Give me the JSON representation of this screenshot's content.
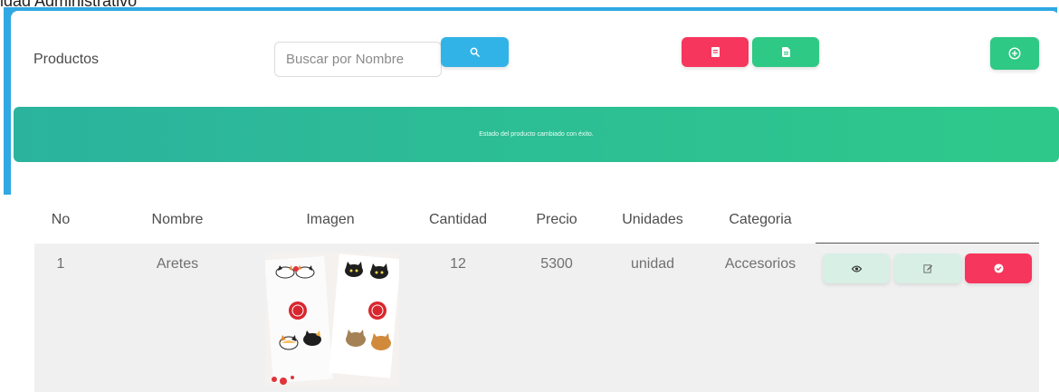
{
  "window": {
    "title": "idad Administrativo"
  },
  "header": {
    "title": "Productos",
    "search": {
      "placeholder": "Buscar por Nombre",
      "value": ""
    }
  },
  "alert": {
    "message": "Estado del producto cambiado con éxito."
  },
  "table": {
    "columns": [
      "No",
      "Nombre",
      "Imagen",
      "Cantidad",
      "Precio",
      "Unidades",
      "Categoria"
    ],
    "rows": [
      {
        "no": "1",
        "nombre": "Aretes",
        "cantidad": "12",
        "precio": "5300",
        "unidades": "unidad",
        "categoria": "Accesorios"
      }
    ]
  },
  "icons": {
    "search": "search-icon",
    "pdf": "pdf-file-icon",
    "excel": "excel-file-icon",
    "add": "plus-circle-icon",
    "view": "eye-icon",
    "edit": "edit-icon",
    "toggle": "check-circle-icon"
  },
  "colors": {
    "frame": "#2fa8e3",
    "primary": "#32b3e8",
    "danger": "#f6365c",
    "success": "#2ec984",
    "alert_start": "#2bb39e",
    "alert_end": "#2ec98a",
    "action_light": "#d7efe5",
    "row_bg": "#f0f0f0"
  }
}
